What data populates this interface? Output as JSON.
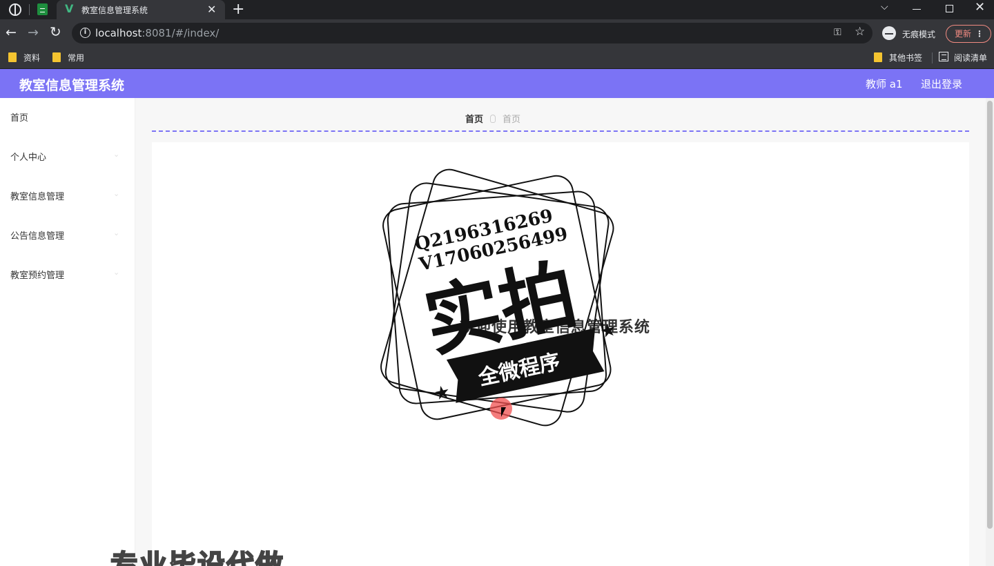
{
  "browser": {
    "tab_title": "教室信息管理系统",
    "url_host": "localhost",
    "url_rest": ":8081/#/index/",
    "incognito_label": "无痕模式",
    "update_label": "更新",
    "bookmarks": [
      "资料",
      "常用"
    ],
    "other_bookmarks": "其他书签",
    "reading_list": "阅读清单"
  },
  "header": {
    "title": "教室信息管理系统",
    "user": "教师 a1",
    "logout": "退出登录",
    "color": "#7b73f5"
  },
  "sidebar": {
    "items": [
      {
        "label": "首页"
      },
      {
        "label": "个人中心"
      },
      {
        "label": "教室信息管理"
      },
      {
        "label": "公告信息管理"
      },
      {
        "label": "教室预约管理"
      }
    ]
  },
  "main": {
    "breadcrumb_home": "首页",
    "breadcrumb_current": "首页",
    "welcome": "欢迎使用教室信息管理系统"
  },
  "watermark": {
    "line1": "Q2196316269",
    "line2": "V17060256499",
    "big": "实拍",
    "banner": "全微程序",
    "bottom": "专业毕设代做"
  }
}
